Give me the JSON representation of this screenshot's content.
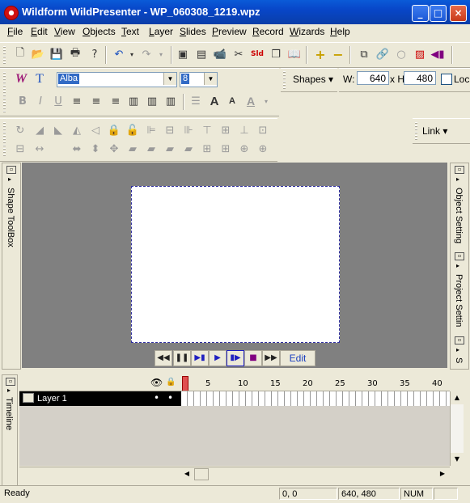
{
  "window": {
    "title": "Wildform WildPresenter - WP_060308_1219.wpz"
  },
  "menu": [
    "File",
    "Edit",
    "View",
    "Objects",
    "Text",
    "Layer",
    "Slides",
    "Preview",
    "Record",
    "Wizards",
    "Help"
  ],
  "text_toolbar": {
    "font_name": "Alba",
    "font_size": "8",
    "shapes_label": "Shapes"
  },
  "size_toolbar": {
    "w_label": "W:",
    "w_value": "640",
    "h_label": "x H:",
    "h_value": "480",
    "lock_label": "Loc"
  },
  "align_toolbar": {
    "link_label": "Link"
  },
  "panels": {
    "left": "Shape ToolBox",
    "right_top": "Object Setting",
    "right_bottom": "Project Settin",
    "right_s": "S"
  },
  "preview_controls": {
    "edit_label": "Edit"
  },
  "timeline": {
    "label": "Timeline",
    "layer_name": "Layer 1",
    "frame_ticks": [
      "5",
      "10",
      "15",
      "20",
      "25",
      "30",
      "35",
      "40"
    ]
  },
  "status": {
    "ready": "Ready",
    "coords": "0, 0",
    "size": "640, 480",
    "num": "NUM"
  }
}
